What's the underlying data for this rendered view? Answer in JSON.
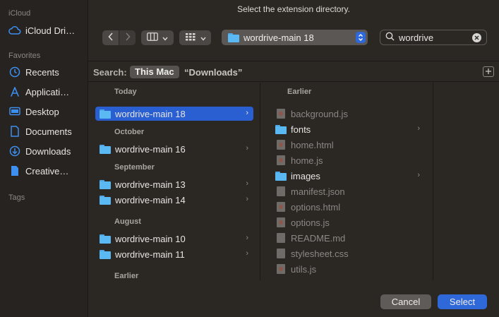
{
  "dialog": {
    "title": "Select the extension directory."
  },
  "sidebar": {
    "sections": [
      {
        "label": "iCloud"
      },
      {
        "label": "Favorites"
      },
      {
        "label": "Tags"
      }
    ],
    "items": [
      {
        "label": "iCloud Dri…",
        "icon": "cloud-icon"
      },
      {
        "label": "Recents",
        "icon": "clock-icon"
      },
      {
        "label": "Applicati…",
        "icon": "applications-icon"
      },
      {
        "label": "Desktop",
        "icon": "desktop-icon"
      },
      {
        "label": "Documents",
        "icon": "document-icon"
      },
      {
        "label": "Downloads",
        "icon": "downloads-icon"
      },
      {
        "label": "Creative…",
        "icon": "file-icon"
      }
    ]
  },
  "toolbar": {
    "path": "wordrive-main 18",
    "search_value": "wordrive"
  },
  "scope": {
    "label": "Search:",
    "this_mac": "This Mac",
    "downloads": "“Downloads”"
  },
  "results": {
    "groups": [
      "Today",
      "October",
      "September",
      "August",
      "Earlier"
    ],
    "rows": [
      "wordrive-main 18",
      "wordrive-main 16",
      "wordrive-main 13",
      "wordrive-main 14",
      "wordrive-main 10",
      "wordrive-main 11"
    ]
  },
  "preview": {
    "group": "Earlier",
    "items": [
      {
        "name": "background.js",
        "type": "file",
        "enabled": false
      },
      {
        "name": "fonts",
        "type": "folder",
        "enabled": true
      },
      {
        "name": "home.html",
        "type": "file",
        "enabled": false
      },
      {
        "name": "home.js",
        "type": "file",
        "enabled": false
      },
      {
        "name": "images",
        "type": "folder",
        "enabled": true
      },
      {
        "name": "manifest.json",
        "type": "file",
        "enabled": false
      },
      {
        "name": "options.html",
        "type": "file",
        "enabled": false
      },
      {
        "name": "options.js",
        "type": "file",
        "enabled": false
      },
      {
        "name": "README.md",
        "type": "file",
        "enabled": false
      },
      {
        "name": "stylesheet.css",
        "type": "file",
        "enabled": false
      },
      {
        "name": "utils.js",
        "type": "file",
        "enabled": false
      }
    ]
  },
  "footer": {
    "cancel": "Cancel",
    "select": "Select"
  },
  "colors": {
    "accent": "#2a5fd1",
    "select_button": "#2f68d8",
    "folder": "#5ab8f2"
  }
}
